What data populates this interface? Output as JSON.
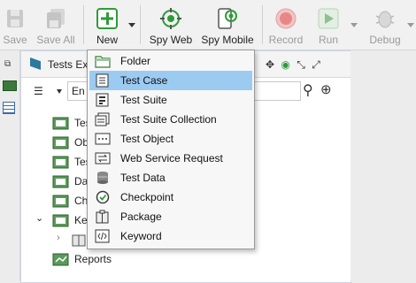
{
  "toolbar": {
    "save": "Save",
    "save_all": "Save All",
    "new": "New",
    "spy_web": "Spy Web",
    "spy_mobile": "Spy Mobile",
    "record": "Record",
    "run": "Run",
    "debug": "Debug"
  },
  "panel": {
    "title": "Tests Exp",
    "search_value": "En"
  },
  "tree": [
    {
      "label": "Tes"
    },
    {
      "label": "Ob"
    },
    {
      "label": "Tes"
    },
    {
      "label": "Da"
    },
    {
      "label": "Ch"
    },
    {
      "label": "Ke"
    },
    {
      "label": ""
    },
    {
      "label": "Reports"
    }
  ],
  "menu": {
    "items": [
      {
        "label": "Folder",
        "icon": "folder-icon"
      },
      {
        "label": "Test Case",
        "icon": "test-case-icon",
        "selected": true
      },
      {
        "label": "Test Suite",
        "icon": "test-suite-icon"
      },
      {
        "label": "Test Suite Collection",
        "icon": "test-suite-collection-icon"
      },
      {
        "label": "Test Object",
        "icon": "test-object-icon"
      },
      {
        "label": "Web Service Request",
        "icon": "web-service-request-icon"
      },
      {
        "label": "Test Data",
        "icon": "test-data-icon"
      },
      {
        "label": "Checkpoint",
        "icon": "checkpoint-icon"
      },
      {
        "label": "Package",
        "icon": "package-icon"
      },
      {
        "label": "Keyword",
        "icon": "keyword-icon"
      }
    ]
  },
  "colors": {
    "menu_selection": "#9ccbf2",
    "new_green": "#2e9b3a",
    "record_red": "#e05555",
    "toolbar_bg": "#f1f1f1"
  }
}
